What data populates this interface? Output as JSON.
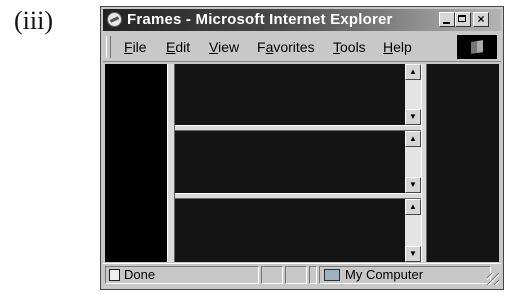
{
  "figure_label": "(iii)",
  "window": {
    "title": "Frames - Microsoft Internet Explorer",
    "buttons": {
      "minimize": "_",
      "maximize": "□",
      "close": "×"
    }
  },
  "menu": [
    {
      "pre": "",
      "underline": "F",
      "post": "ile"
    },
    {
      "pre": "",
      "underline": "E",
      "post": "dit"
    },
    {
      "pre": "",
      "underline": "V",
      "post": "iew"
    },
    {
      "pre": "F",
      "underline": "a",
      "post": "vorites"
    },
    {
      "pre": "",
      "underline": "T",
      "post": "ools"
    },
    {
      "pre": "",
      "underline": "H",
      "post": "elp"
    }
  ],
  "scroll": {
    "up": "▲",
    "down": "▼"
  },
  "status": {
    "text": "Done",
    "zone": "My Computer"
  }
}
